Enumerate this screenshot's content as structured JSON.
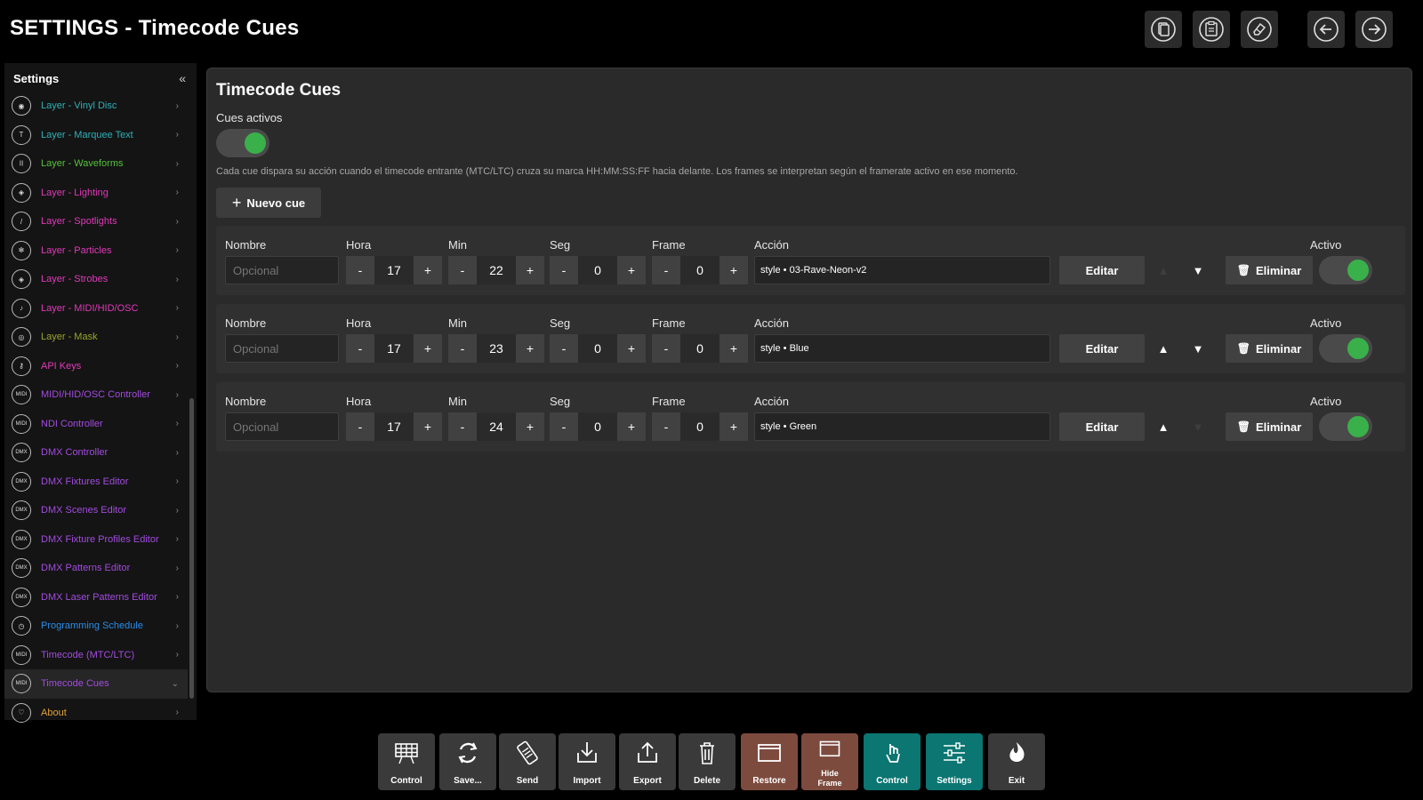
{
  "header": {
    "title": "SETTINGS - Timecode Cues",
    "buttons": [
      {
        "icon": "copy-icon"
      },
      {
        "icon": "paste-icon"
      },
      {
        "icon": "eraser-icon"
      },
      {
        "icon": "back-arrow-icon"
      },
      {
        "icon": "forward-arrow-icon"
      }
    ]
  },
  "sidebar": {
    "title": "Settings",
    "collapse": "«",
    "items": [
      {
        "label": "Layer - Vinyl Disc",
        "icon": "◉",
        "color": "#2fb0b8"
      },
      {
        "label": "Layer - Marquee Text",
        "icon": "T",
        "color": "#2fb0b8"
      },
      {
        "label": "Layer - Waveforms",
        "icon": "|||",
        "color": "#56c23c"
      },
      {
        "label": "Layer - Lighting",
        "icon": "◈",
        "color": "#e13ab9"
      },
      {
        "label": "Layer - Spotlights",
        "icon": "/",
        "color": "#e13ab9"
      },
      {
        "label": "Layer - Particles",
        "icon": "✻",
        "color": "#e13ab9"
      },
      {
        "label": "Layer - Strobes",
        "icon": "◈",
        "color": "#e13ab9"
      },
      {
        "label": "Layer - MIDI/HID/OSC",
        "icon": "♪",
        "color": "#e13ab9"
      },
      {
        "label": "Layer - Mask",
        "icon": "◎",
        "color": "#9aa42a"
      },
      {
        "label": "API Keys",
        "icon": "⚷",
        "color": "#e13ab9"
      },
      {
        "label": "MIDI/HID/OSC Controller",
        "icon": "MIDI",
        "color": "#a24be0"
      },
      {
        "label": "NDI Controller",
        "icon": "MIDI",
        "color": "#a24be0"
      },
      {
        "label": "DMX Controller",
        "icon": "DMX",
        "color": "#a24be0"
      },
      {
        "label": "DMX Fixtures Editor",
        "icon": "DMX",
        "color": "#a24be0"
      },
      {
        "label": "DMX Scenes Editor",
        "icon": "DMX",
        "color": "#a24be0"
      },
      {
        "label": "DMX Fixture Profiles Editor",
        "icon": "DMX",
        "color": "#a24be0"
      },
      {
        "label": "DMX Patterns Editor",
        "icon": "DMX",
        "color": "#a24be0"
      },
      {
        "label": "DMX Laser Patterns Editor",
        "icon": "DMX",
        "color": "#a24be0"
      },
      {
        "label": "Programming Schedule",
        "icon": "◷",
        "color": "#2a8ce8"
      },
      {
        "label": "Timecode (MTC/LTC)",
        "icon": "MIDI",
        "color": "#a24be0"
      },
      {
        "label": "Timecode Cues",
        "icon": "MIDI",
        "color": "#a24be0",
        "active": true
      },
      {
        "label": "About",
        "icon": "♡",
        "color": "#e0a13a"
      }
    ]
  },
  "main": {
    "heading": "Timecode Cues",
    "active_label": "Cues activos",
    "help_text": "Cada cue dispara su acción cuando el timecode entrante (MTC/LTC) cruza su marca HH:MM:SS:FF hacia delante. Los frames se interpretan según el framerate activo en ese momento.",
    "new_cue": "Nuevo cue",
    "labels": {
      "name": "Nombre",
      "hour": "Hora",
      "min": "Min",
      "sec": "Seg",
      "frame": "Frame",
      "action": "Acción",
      "active": "Activo",
      "placeholder": "Opcional",
      "edit": "Editar",
      "delete": "Eliminar",
      "minus": "-",
      "plus": "+",
      "up": "▲",
      "down": "▼"
    },
    "cues": [
      {
        "hour": "17",
        "min": "22",
        "sec": "0",
        "frame": "0",
        "action": "style • 03-Rave-Neon-v2",
        "active": true,
        "up_enabled": false,
        "down_enabled": true
      },
      {
        "hour": "17",
        "min": "23",
        "sec": "0",
        "frame": "0",
        "action": "style • Blue",
        "active": true,
        "up_enabled": true,
        "down_enabled": true
      },
      {
        "hour": "17",
        "min": "24",
        "sec": "0",
        "frame": "0",
        "action": "style • Green",
        "active": true,
        "up_enabled": true,
        "down_enabled": false
      }
    ]
  },
  "toolbar": {
    "buttons": [
      {
        "label": "Control",
        "icon": "grid-icon",
        "style": "normal"
      },
      {
        "label": "Save...",
        "icon": "sync-icon",
        "style": "normal"
      },
      {
        "label": "Send",
        "icon": "send-icon",
        "style": "normal"
      },
      {
        "label": "Import",
        "icon": "import-icon",
        "style": "normal"
      },
      {
        "label": "Export",
        "icon": "export-icon",
        "style": "normal"
      },
      {
        "label": "Delete",
        "icon": "trash-icon",
        "style": "normal"
      },
      {
        "label": "Restore",
        "icon": "window-icon",
        "style": "restore"
      },
      {
        "label": "Hide Frame",
        "icon": "frame-icon",
        "style": "restore"
      },
      {
        "label": "Control",
        "icon": "touch-icon",
        "style": "teal"
      },
      {
        "label": "Settings",
        "icon": "sliders-icon",
        "style": "teal"
      },
      {
        "label": "Exit",
        "icon": "flame-icon",
        "style": "normal"
      }
    ]
  },
  "colors": {
    "toggle_on": "#3ab04a",
    "restore_btn": "#7d4b3e",
    "teal_btn": "#0b7672"
  }
}
